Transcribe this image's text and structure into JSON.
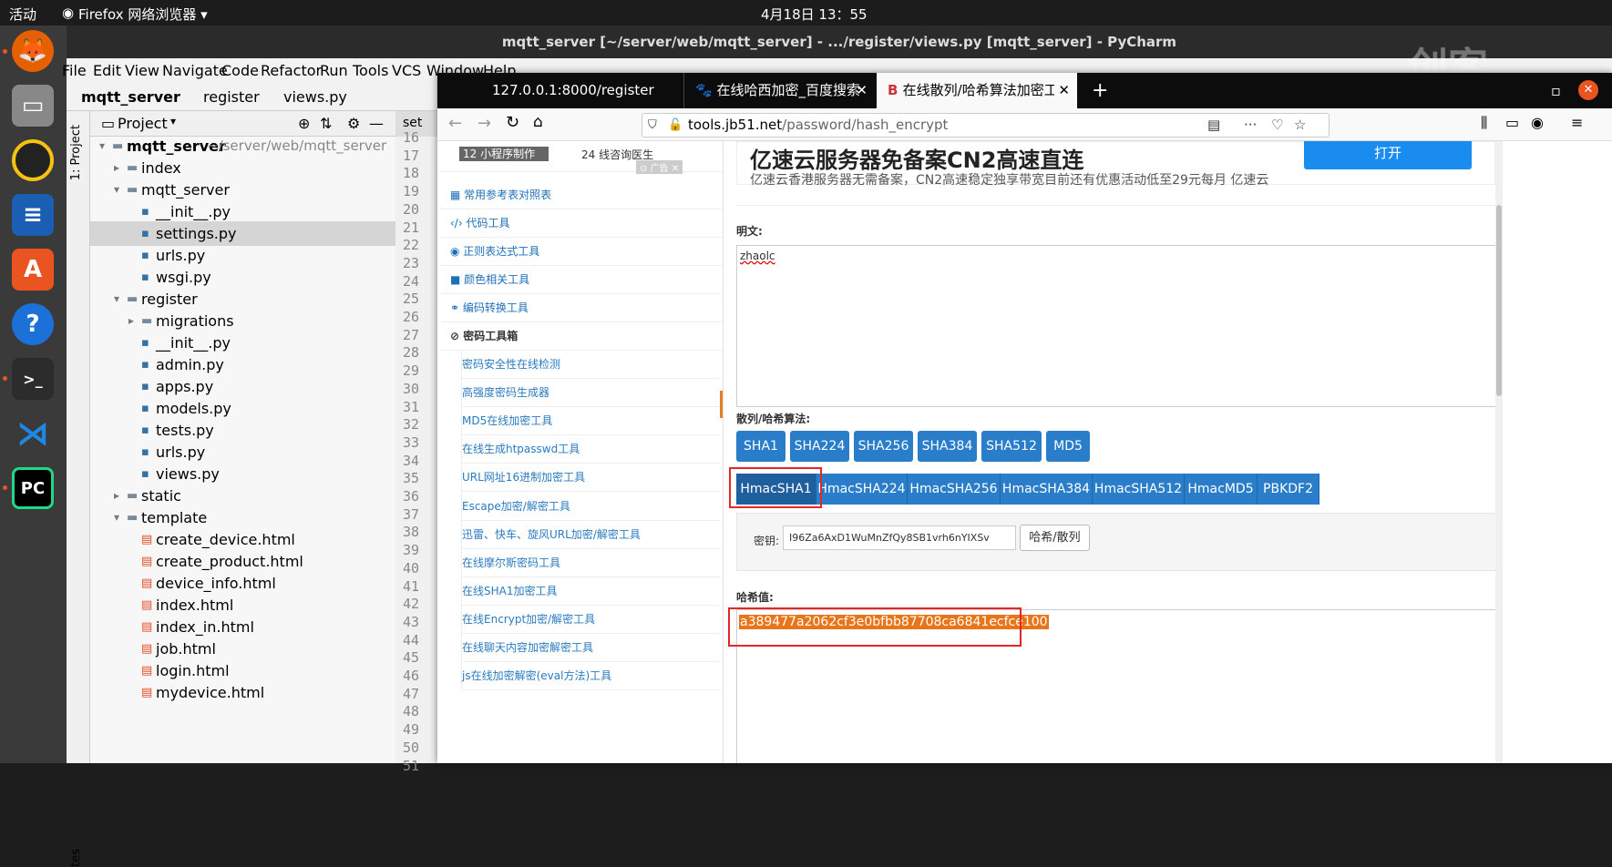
{
  "topbar": {
    "activities": "活动",
    "app": "Firefox 网络浏览器 ▾",
    "clock": "4月18日  13：55"
  },
  "pycharm": {
    "title": "mqtt_server [~/server/web/mqtt_server] - .../register/views.py [mqtt_server] - PyCharm",
    "menu": [
      "File",
      "Edit",
      "View",
      "Navigate",
      "Code",
      "Refactor",
      "Run",
      "Tools",
      "VCS",
      "Window",
      "Help"
    ],
    "breadcrumb": [
      "mqtt_server",
      "register",
      "views.py"
    ],
    "project_header": "Project",
    "side_tab": "1: Project",
    "bottom_side_tab": "tes",
    "editor_tab": "set",
    "tree": [
      {
        "label": "mqtt_server",
        "extra": "~/server/web/mqtt_server",
        "indent": 0,
        "kind": "folder",
        "open": true
      },
      {
        "label": "index",
        "indent": 1,
        "kind": "folder",
        "open": false
      },
      {
        "label": "mqtt_server",
        "indent": 1,
        "kind": "folder",
        "open": true
      },
      {
        "label": "__init__.py",
        "indent": 2,
        "kind": "py"
      },
      {
        "label": "settings.py",
        "indent": 2,
        "kind": "py",
        "selected": true
      },
      {
        "label": "urls.py",
        "indent": 2,
        "kind": "py"
      },
      {
        "label": "wsgi.py",
        "indent": 2,
        "kind": "py"
      },
      {
        "label": "register",
        "indent": 1,
        "kind": "folder",
        "open": true
      },
      {
        "label": "migrations",
        "indent": 2,
        "kind": "folder",
        "open": false
      },
      {
        "label": "__init__.py",
        "indent": 2,
        "kind": "py"
      },
      {
        "label": "admin.py",
        "indent": 2,
        "kind": "py"
      },
      {
        "label": "apps.py",
        "indent": 2,
        "kind": "py"
      },
      {
        "label": "models.py",
        "indent": 2,
        "kind": "py"
      },
      {
        "label": "tests.py",
        "indent": 2,
        "kind": "py"
      },
      {
        "label": "urls.py",
        "indent": 2,
        "kind": "py"
      },
      {
        "label": "views.py",
        "indent": 2,
        "kind": "py"
      },
      {
        "label": "static",
        "indent": 1,
        "kind": "folder",
        "open": false
      },
      {
        "label": "template",
        "indent": 1,
        "kind": "folder",
        "open": true
      },
      {
        "label": "create_device.html",
        "indent": 2,
        "kind": "html"
      },
      {
        "label": "create_product.html",
        "indent": 2,
        "kind": "html"
      },
      {
        "label": "device_info.html",
        "indent": 2,
        "kind": "html"
      },
      {
        "label": "index.html",
        "indent": 2,
        "kind": "html"
      },
      {
        "label": "index_in.html",
        "indent": 2,
        "kind": "html"
      },
      {
        "label": "job.html",
        "indent": 2,
        "kind": "html"
      },
      {
        "label": "login.html",
        "indent": 2,
        "kind": "html"
      },
      {
        "label": "mydevice.html",
        "indent": 2,
        "kind": "html"
      }
    ],
    "line_numbers": [
      "16",
      "17",
      "18",
      "19",
      "20",
      "21",
      "22",
      "23",
      "24",
      "25",
      "26",
      "27",
      "28",
      "29",
      "30",
      "31",
      "32",
      "33",
      "34",
      "35",
      "36",
      "37",
      "38",
      "39",
      "40",
      "41",
      "42",
      "43",
      "44",
      "45",
      "46",
      "47",
      "48",
      "49",
      "50",
      "51"
    ]
  },
  "firefox": {
    "tabs": [
      {
        "label": "127.0.0.1:8000/register"
      },
      {
        "label": "在线哈西加密_百度搜索"
      },
      {
        "label": "在线散列/哈希算法加密工"
      }
    ],
    "url_domain": "tools.jb51.net",
    "url_path": "/password/hash_encrypt",
    "ad_partial": {
      "item1": "12 小程序制作",
      "item2": "24 线咨询医生",
      "badge": "⊙ 广告 ✕"
    },
    "ad": {
      "title": "亿速云服务器免备案CN2高速直连",
      "desc": "亿速云香港服务器无需备案，CN2高速稳定独享带宽目前还有优惠活动低至29元每月 亿速云",
      "button": "打开"
    },
    "sidebar": [
      {
        "label": "常用参考表对照表",
        "icon": "table-icon"
      },
      {
        "label": "代码工具",
        "icon": "code-icon"
      },
      {
        "label": "正则表达式工具",
        "icon": "regex-icon"
      },
      {
        "label": "颜色相关工具",
        "icon": "color-icon"
      },
      {
        "label": "编码转换工具",
        "icon": "link-icon"
      },
      {
        "label": "密码工具箱",
        "icon": "lock-icon",
        "active": true
      }
    ],
    "sub_items": [
      "密码安全性在线检测",
      "高强度密码生成器",
      "MD5在线加密工具",
      "在线生成htpasswd工具",
      "URL网址16进制加密工具",
      "Escape加密/解密工具",
      "迅雷、快车、旋风URL加密/解密工具",
      "在线摩尔斯密码工具",
      "在线SHA1加密工具",
      "在线Encrypt加密/解密工具",
      "在线聊天内容加密解密工具",
      "js在线加密解密(eval方法)工具"
    ],
    "plaintext_label": "明文:",
    "plaintext_value": "zhaolc",
    "algo_label": "散列/哈希算法:",
    "algos": [
      "SHA1",
      "SHA224",
      "SHA256",
      "SHA384",
      "SHA512",
      "MD5"
    ],
    "hmac_algos": [
      "HmacSHA1",
      "HmacSHA224",
      "HmacSHA256",
      "HmacSHA384",
      "HmacSHA512",
      "HmacMD5",
      "PBKDF2"
    ],
    "key_label": "密钥:",
    "key_value": "I96Za6AxD1WuMnZfQy8SB1vrh6nYIXSv",
    "hash_button": "哈希/散列",
    "hash_label": "哈希值:",
    "hash_value": "a389477a2062cf3e0bfbb87708ca6841ecfce100"
  },
  "watermark": "创客"
}
